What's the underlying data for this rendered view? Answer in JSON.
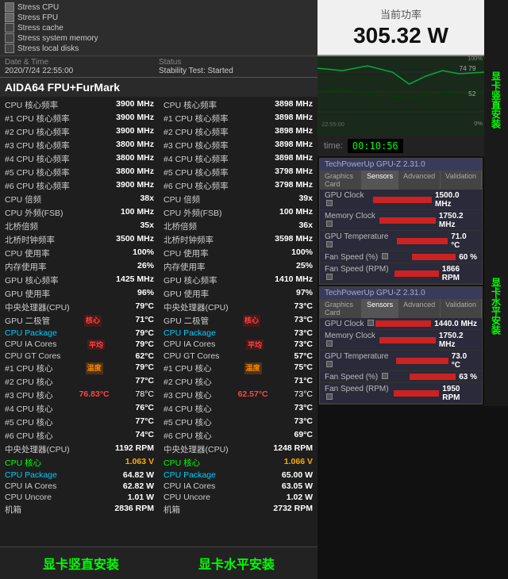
{
  "stress": {
    "options": [
      {
        "label": "Stress CPU",
        "checked": true
      },
      {
        "label": "Stress FPU",
        "checked": true
      },
      {
        "label": "Stress cache",
        "checked": false
      },
      {
        "label": "Stress system memory",
        "checked": false
      },
      {
        "label": "Stress local disks",
        "checked": false
      }
    ]
  },
  "status": {
    "date_label": "Date & Time",
    "status_label": "Status",
    "datetime": "2020/7/24 22:55:00",
    "status_value": "Stability Test: Started"
  },
  "title": "AIDA64 FPU+FurMark",
  "col1": {
    "rows": [
      {
        "label": "CPU 核心频率",
        "value": "3900 MHz",
        "type": "normal"
      },
      {
        "label": "#1 CPU 核心频率",
        "value": "3900 MHz",
        "type": "normal"
      },
      {
        "label": "#2 CPU 核心频率",
        "value": "3900 MHz",
        "type": "normal"
      },
      {
        "label": "#3 CPU 核心频率",
        "value": "3800 MHz",
        "type": "normal"
      },
      {
        "label": "#4 CPU 核心频率",
        "value": "3800 MHz",
        "type": "normal"
      },
      {
        "label": "#5 CPU 核心频率",
        "value": "3800 MHz",
        "type": "normal"
      },
      {
        "label": "#6 CPU 核心频率",
        "value": "3900 MHz",
        "type": "normal"
      },
      {
        "label": "CPU 倍频",
        "value": "38x",
        "type": "normal"
      },
      {
        "label": "CPU 外频(FSB)",
        "value": "100 MHz",
        "type": "normal"
      },
      {
        "label": "北桥倍频",
        "value": "35x",
        "type": "normal"
      },
      {
        "label": "北桥时钟频率",
        "value": "3500 MHz",
        "type": "normal"
      },
      {
        "label": "CPU 使用率",
        "value": "100%",
        "type": "normal"
      },
      {
        "label": "内存使用率",
        "value": "26%",
        "type": "normal"
      },
      {
        "label": "GPU 核心频率",
        "value": "1425 MHz",
        "type": "normal"
      },
      {
        "label": "GPU 使用率",
        "value": "96%",
        "type": "normal"
      },
      {
        "label": "中央处理器(CPU)",
        "value": "79°C",
        "type": "normal"
      },
      {
        "label": "GPU 二极管",
        "value": "71°C",
        "type": "red_label"
      },
      {
        "label": "CPU Package",
        "value": "79°C",
        "type": "normal"
      },
      {
        "label": "CPU IA Cores",
        "value": "79°C",
        "type": "red_label"
      },
      {
        "label": "CPU GT Cores",
        "value": "62°C",
        "type": "normal"
      },
      {
        "label": "#1 CPU 核心",
        "value": "79°C",
        "type": "red_label"
      },
      {
        "label": "#2 CPU 核心",
        "value": "77°C",
        "type": "normal"
      },
      {
        "label": "#3 CPU 核心",
        "value": "76.83°C",
        "value2": "78°C",
        "type": "highlight"
      },
      {
        "label": "#4 CPU 核心",
        "value": "76°C",
        "type": "normal"
      },
      {
        "label": "#5 CPU 核心",
        "value": "77°C",
        "type": "normal"
      },
      {
        "label": "#6 CPU 核心",
        "value": "74°C",
        "type": "normal"
      },
      {
        "label": "中央处理器(CPU)",
        "value": "1192 RPM",
        "type": "normal"
      },
      {
        "label": "CPU 核心",
        "value": "1.063 V",
        "type": "voltage"
      },
      {
        "label": "CPU Package",
        "value": "64.82 W",
        "type": "normal"
      },
      {
        "label": "CPU IA Cores",
        "value": "62.82 W",
        "type": "normal"
      },
      {
        "label": "CPU Uncore",
        "value": "1.01 W",
        "type": "normal"
      },
      {
        "label": "机箱",
        "value": "2836 RPM",
        "type": "normal"
      }
    ]
  },
  "col2": {
    "rows": [
      {
        "label": "CPU 核心频率",
        "value": "3898 MHz",
        "type": "normal"
      },
      {
        "label": "#1 CPU 核心频率",
        "value": "3898 MHz",
        "type": "normal"
      },
      {
        "label": "#2 CPU 核心频率",
        "value": "3898 MHz",
        "type": "normal"
      },
      {
        "label": "#3 CPU 核心频率",
        "value": "3898 MHz",
        "type": "normal"
      },
      {
        "label": "#4 CPU 核心频率",
        "value": "3898 MHz",
        "type": "normal"
      },
      {
        "label": "#5 CPU 核心频率",
        "value": "3798 MHz",
        "type": "normal"
      },
      {
        "label": "#6 CPU 核心频率",
        "value": "3798 MHz",
        "type": "normal"
      },
      {
        "label": "CPU 倍频",
        "value": "39x",
        "type": "normal"
      },
      {
        "label": "CPU 外频(FSB)",
        "value": "100 MHz",
        "type": "normal"
      },
      {
        "label": "北桥倍频",
        "value": "36x",
        "type": "normal"
      },
      {
        "label": "北桥时钟频率",
        "value": "3598 MHz",
        "type": "normal"
      },
      {
        "label": "CPU 使用率",
        "value": "100%",
        "type": "normal"
      },
      {
        "label": "内存使用率",
        "value": "25%",
        "type": "normal"
      },
      {
        "label": "GPU 核心频率",
        "value": "1410 MHz",
        "type": "normal"
      },
      {
        "label": "GPU 使用率",
        "value": "97%",
        "type": "normal"
      },
      {
        "label": "中央处理器(CPU)",
        "value": "73°C",
        "type": "normal"
      },
      {
        "label": "GPU 二极管",
        "value": "73°C",
        "type": "red_label"
      },
      {
        "label": "CPU Package",
        "value": "73°C",
        "type": "normal"
      },
      {
        "label": "CPU IA Cores",
        "value": "73°C",
        "type": "red_label"
      },
      {
        "label": "CPU GT Cores",
        "value": "57°C",
        "type": "normal"
      },
      {
        "label": "#1 CPU 核心",
        "value": "75°C",
        "type": "red_label"
      },
      {
        "label": "#2 CPU 核心",
        "value": "71°C",
        "type": "normal"
      },
      {
        "label": "#3 CPU 核心",
        "value": "62.57°C",
        "value2": "73°C",
        "type": "highlight"
      },
      {
        "label": "#4 CPU 核心",
        "value": "73°C",
        "type": "normal"
      },
      {
        "label": "#5 CPU 核心",
        "value": "73°C",
        "type": "normal"
      },
      {
        "label": "#6 CPU 核心",
        "value": "69°C",
        "type": "normal"
      },
      {
        "label": "中央处理器(CPU)",
        "value": "1248 RPM",
        "type": "normal"
      },
      {
        "label": "CPU 核心",
        "value": "1.066 V",
        "type": "voltage"
      },
      {
        "label": "CPU Package",
        "value": "65.00 W",
        "type": "normal"
      },
      {
        "label": "CPU IA Cores",
        "value": "63.05 W",
        "type": "normal"
      },
      {
        "label": "CPU Uncore",
        "value": "1.02 W",
        "type": "normal"
      },
      {
        "label": "机箱",
        "value": "2732 RPM",
        "type": "normal"
      }
    ]
  },
  "power": {
    "label": "当前功率",
    "value": "305.32 W"
  },
  "chart": {
    "values": [
      74,
      79,
      52,
      60,
      55,
      70,
      75,
      80
    ],
    "labels": [
      "74 79",
      "52"
    ]
  },
  "timer": {
    "label": "time:",
    "value": "00:10:56"
  },
  "gpuz1": {
    "title": "TechPowerUp GPU-Z 2.31.0",
    "tabs": [
      "Graphics Card",
      "Sensors",
      "Advanced",
      "Validation"
    ],
    "rows": [
      {
        "label": "GPU Clock",
        "value": "1500.0 MHz",
        "bar": 75
      },
      {
        "label": "Memory Clock",
        "value": "1750.2 MHz",
        "bar": 80
      },
      {
        "label": "GPU Temperature",
        "value": "71.0 °C",
        "bar": 65
      },
      {
        "label": "Fan Speed (%)",
        "value": "60 %",
        "bar": 55
      },
      {
        "label": "Fan Speed (RPM)",
        "value": "1866 RPM",
        "bar": 60
      }
    ]
  },
  "gpuz2": {
    "title": "TechPowerUp GPU-Z 2.31.0",
    "tabs": [
      "Graphics Card",
      "Sensors",
      "Advanced",
      "Validation"
    ],
    "rows": [
      {
        "label": "GPU Clock",
        "value": "1440.0 MHz",
        "bar": 70
      },
      {
        "label": "Memory Clock",
        "value": "1750.2 MHz",
        "bar": 80
      },
      {
        "label": "GPU Temperature",
        "value": "73.0 °C",
        "bar": 68
      },
      {
        "label": "Fan Speed (%)",
        "value": "63 %",
        "bar": 58
      },
      {
        "label": "Fan Speed (RPM)",
        "value": "1950 RPM",
        "bar": 62
      }
    ]
  },
  "bottom_labels": {
    "left": "显卡竖直安装",
    "right": "显卡水平安装"
  },
  "side_labels": {
    "vertical1": "显卡竖直安装",
    "horizontal1": "显卡水平安装"
  },
  "red_labels": {
    "core": "核心",
    "avg": "平均",
    "temp": "温度"
  }
}
